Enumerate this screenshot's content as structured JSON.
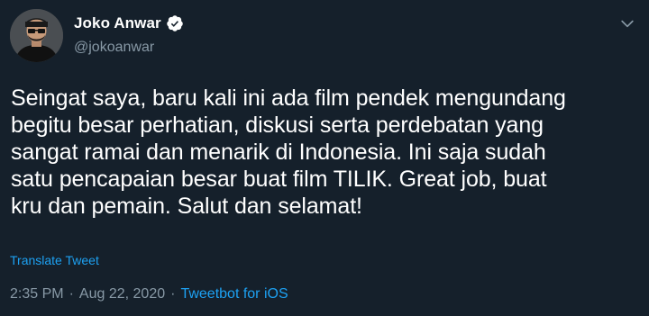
{
  "tweet": {
    "author": {
      "display_name": "Joko Anwar",
      "handle": "@jokoanwar",
      "verified": true
    },
    "text": "Seingat saya, baru kali ini ada film pendek mengundang\nbegitu besar perhatian, diskusi serta perdebatan yang\nsangat ramai dan menarik di Indonesia. Ini saja sudah\nsatu pencapaian besar buat film TILIK. Great job, buat\nkru dan pemain. Salut dan selamat!",
    "translate_label": "Translate Tweet",
    "time": "2:35 PM",
    "separator": "·",
    "date": "Aug 22, 2020",
    "source": "Tweetbot for iOS"
  },
  "colors": {
    "background": "#15202b",
    "text": "#ffffff",
    "secondary": "#8899a6",
    "accent": "#1da1f2"
  },
  "icons": {
    "verified": "verified-badge-icon",
    "menu": "chevron-down-icon"
  }
}
